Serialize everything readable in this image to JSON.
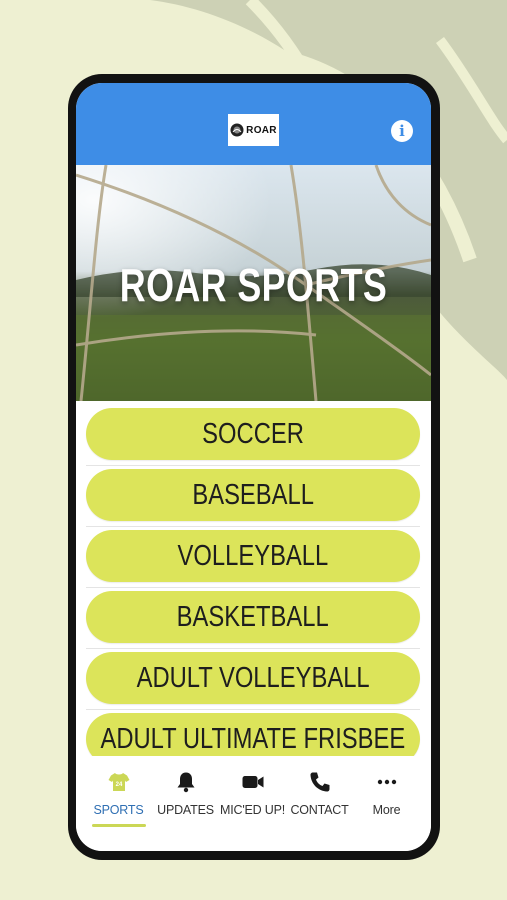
{
  "app": {
    "logo_text": "ROAR",
    "hero_title": "ROAR SPORTS"
  },
  "sports": [
    {
      "label": "SOCCER"
    },
    {
      "label": "BASEBALL"
    },
    {
      "label": "VOLLEYBALL"
    },
    {
      "label": "BASKETBALL"
    },
    {
      "label": "ADULT VOLLEYBALL"
    },
    {
      "label": "ADULT ULTIMATE FRISBEE"
    }
  ],
  "tabs": [
    {
      "label": "SPORTS",
      "icon": "shirt-icon",
      "active": true
    },
    {
      "label": "UPDATES",
      "icon": "bell-icon"
    },
    {
      "label": "MIC'ED UP!",
      "icon": "video-camera-icon"
    },
    {
      "label": "CONTACT",
      "icon": "phone-icon"
    },
    {
      "label": "More",
      "icon": "more-dots-icon"
    }
  ],
  "colors": {
    "background": "#eef0d2",
    "header": "#3e8de6",
    "button": "#dce45a",
    "tab_active_label": "#2f6fb3",
    "tab_underline": "#cbd756"
  }
}
